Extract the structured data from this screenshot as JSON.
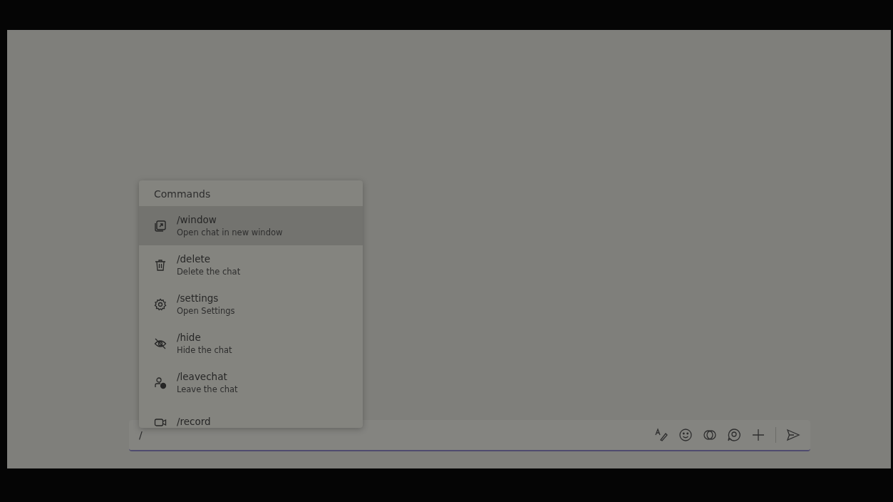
{
  "commands_popup": {
    "heading": "Commands",
    "items": [
      {
        "command": "/window",
        "description": "Open chat in new window",
        "selected": true
      },
      {
        "command": "/delete",
        "description": "Delete the chat",
        "selected": false
      },
      {
        "command": "/settings",
        "description": "Open Settings",
        "selected": false
      },
      {
        "command": "/hide",
        "description": "Hide the chat",
        "selected": false
      },
      {
        "command": "/leavechat",
        "description": "Leave the chat",
        "selected": false
      },
      {
        "command": "/record",
        "selected": false
      }
    ]
  },
  "compose_box": {
    "value": "/"
  }
}
